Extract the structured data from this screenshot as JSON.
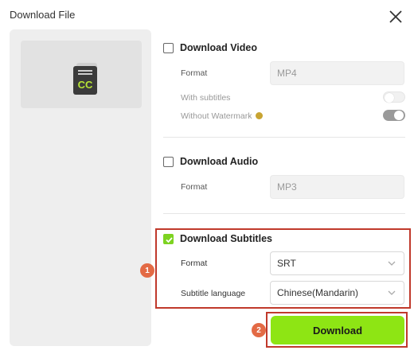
{
  "window": {
    "title": "Download File"
  },
  "preview": {
    "icon_text": "CC"
  },
  "video": {
    "title": "Download Video",
    "format_label": "Format",
    "format_value": "MP4",
    "with_subtitles_label": "With subtitles",
    "with_subtitles_on": false,
    "without_watermark_label": "Without Watermark",
    "without_watermark_on": true
  },
  "audio": {
    "title": "Download Audio",
    "format_label": "Format",
    "format_value": "MP3"
  },
  "subtitles": {
    "title": "Download Subtitles",
    "checked": true,
    "format_label": "Format",
    "format_value": "SRT",
    "language_label": "Subtitle language",
    "language_value": "Chinese(Mandarin)"
  },
  "markers": {
    "m1": "1",
    "m2": "2"
  },
  "actions": {
    "download_label": "Download"
  },
  "colors": {
    "accent": "#8EE514",
    "highlight": "#C0392B",
    "marker": "#E36A45"
  }
}
